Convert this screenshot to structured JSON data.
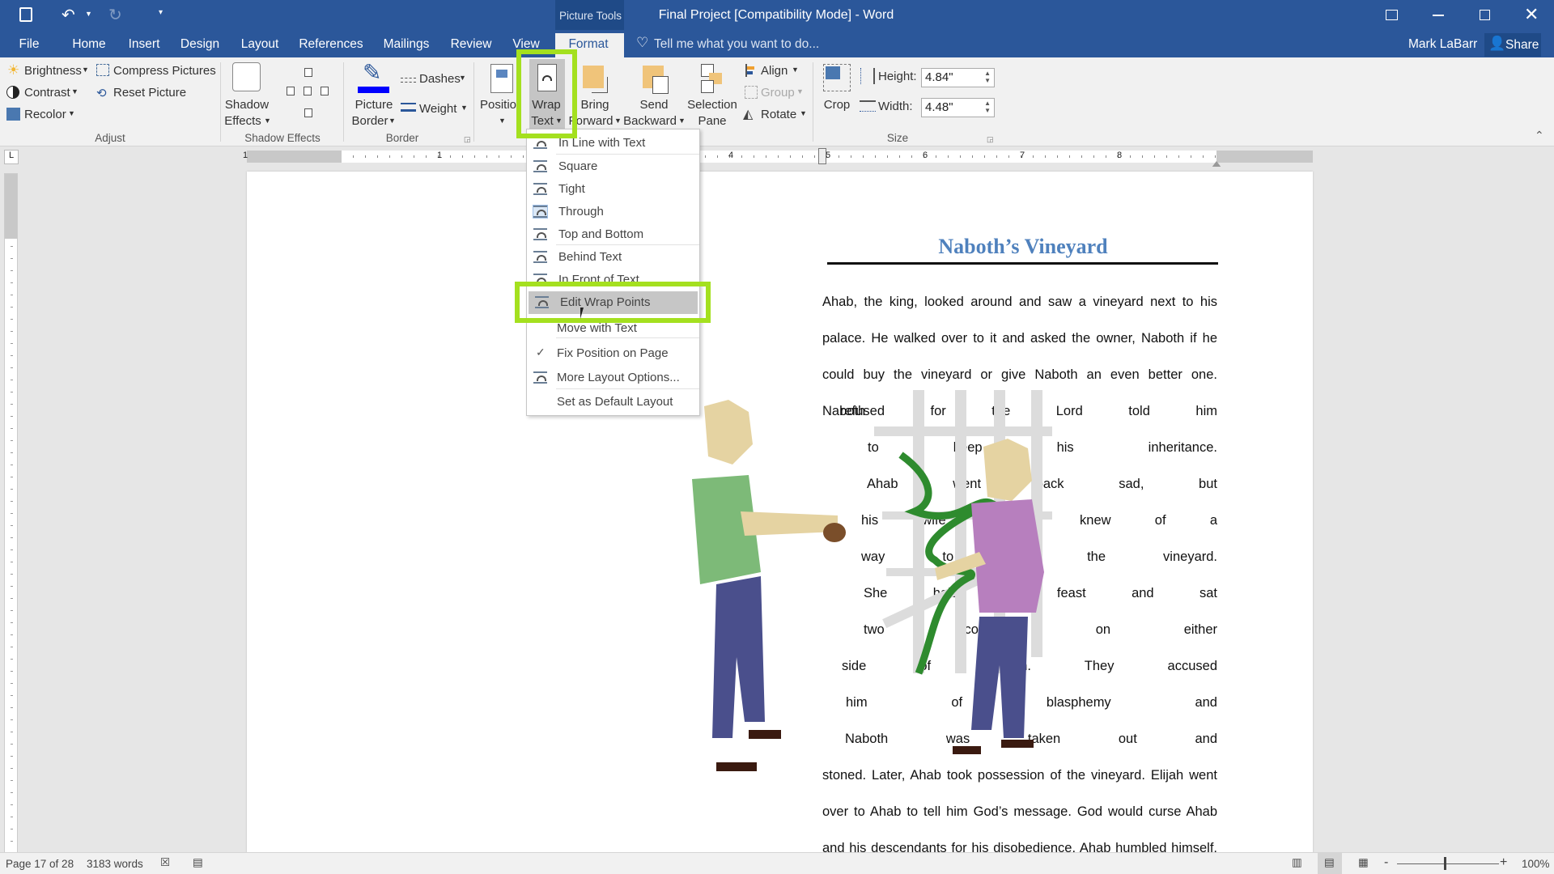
{
  "window": {
    "title": "Final Project [Compatibility Mode] - Word",
    "context_tab_group": "Picture Tools",
    "user": "Mark LaBarr",
    "share_label": "Share"
  },
  "tabs": [
    {
      "label": "File"
    },
    {
      "label": "Home"
    },
    {
      "label": "Insert"
    },
    {
      "label": "Design"
    },
    {
      "label": "Layout"
    },
    {
      "label": "References"
    },
    {
      "label": "Mailings"
    },
    {
      "label": "Review"
    },
    {
      "label": "View"
    },
    {
      "label": "Format",
      "selected": true
    }
  ],
  "tell_me": "Tell me what you want to do...",
  "ribbon": {
    "adjust": {
      "label": "Adjust",
      "brightness": "Brightness",
      "contrast": "Contrast",
      "recolor": "Recolor",
      "compress": "Compress Pictures",
      "reset": "Reset Picture"
    },
    "shadow": {
      "label": "Shadow Effects",
      "btn1": "Shadow",
      "btn2": "Effects"
    },
    "border": {
      "label": "Border",
      "btn1": "Picture",
      "btn2": "Border",
      "dashes": "Dashes",
      "weight": "Weight",
      "border_color": "#0000ff"
    },
    "arrange": {
      "position": "Positio",
      "wrap1": "Wrap",
      "wrap2": "Text",
      "bring1": "Bring",
      "bring2": "Forward",
      "send1": "Send",
      "send2": "Backward",
      "sel1": "Selection",
      "sel2": "Pane",
      "align": "Align",
      "group": "Group",
      "rotate": "Rotate"
    },
    "size": {
      "label": "Size",
      "crop": "Crop",
      "height_label": "Height:",
      "height": "4.84\"",
      "width_label": "Width:",
      "width": "4.48\""
    }
  },
  "ruler": {
    "numbers": [
      "1",
      "1",
      "4",
      "5",
      "6",
      "7",
      "8"
    ]
  },
  "wrap_menu": {
    "items": [
      {
        "label": "In Line with Text",
        "icon": "inline-icon"
      },
      {
        "label": "Square",
        "icon": "wrap-square-icon"
      },
      {
        "label": "Tight",
        "icon": "wrap-tight-icon"
      },
      {
        "label": "Through",
        "icon": "wrap-through-icon",
        "selected": true
      },
      {
        "label": "Top and Bottom",
        "icon": "wrap-top-bottom-icon"
      },
      {
        "label": "Behind Text",
        "icon": "behind-text-icon"
      },
      {
        "label": "In Front of Text",
        "icon": "in-front-text-icon"
      },
      {
        "label": "Edit Wrap Points",
        "icon": "edit-wrap-points-icon",
        "hovered": true
      },
      {
        "label": "Move with Text"
      },
      {
        "label": "Fix Position on Page",
        "checked": true
      },
      {
        "label": "More Layout Options...",
        "icon": "layout-options-icon"
      },
      {
        "label": "Set as Default Layout"
      }
    ],
    "highlight_color": "#a4e01f"
  },
  "document": {
    "title": "Naboth’s Vineyard",
    "title_color": "#4f81bd",
    "lines": [
      "Ahab, the king, looked around and saw a vineyard next to his",
      "palace. He walked over to it and asked the owner, Naboth if he",
      "could buy the vineyard or give Naboth an even better one.",
      "Naboth",
      "refused for the Lord told him",
      "to keep his inheritance.",
      "Ahab went back sad, but",
      "his wife Jezebel knew of a",
      "way to get the vineyard.",
      "She held a feast and sat",
      "two scoundrels on either",
      "side of Naboth. They accused",
      "him of blasphemy and",
      "Naboth was taken out and",
      "stoned. Later, Ahab took possession of the vineyard. Elijah went",
      "over to Ahab to tell him God’s message. God would curse Ahab",
      "and his descendants for his disobedience. Ahab humbled himself,"
    ]
  },
  "status": {
    "page": "Page 17 of 28",
    "words": "3183 words",
    "zoom": "100%",
    "zoom_minus": "-",
    "zoom_plus": "+",
    "zoom_percent": 100
  }
}
